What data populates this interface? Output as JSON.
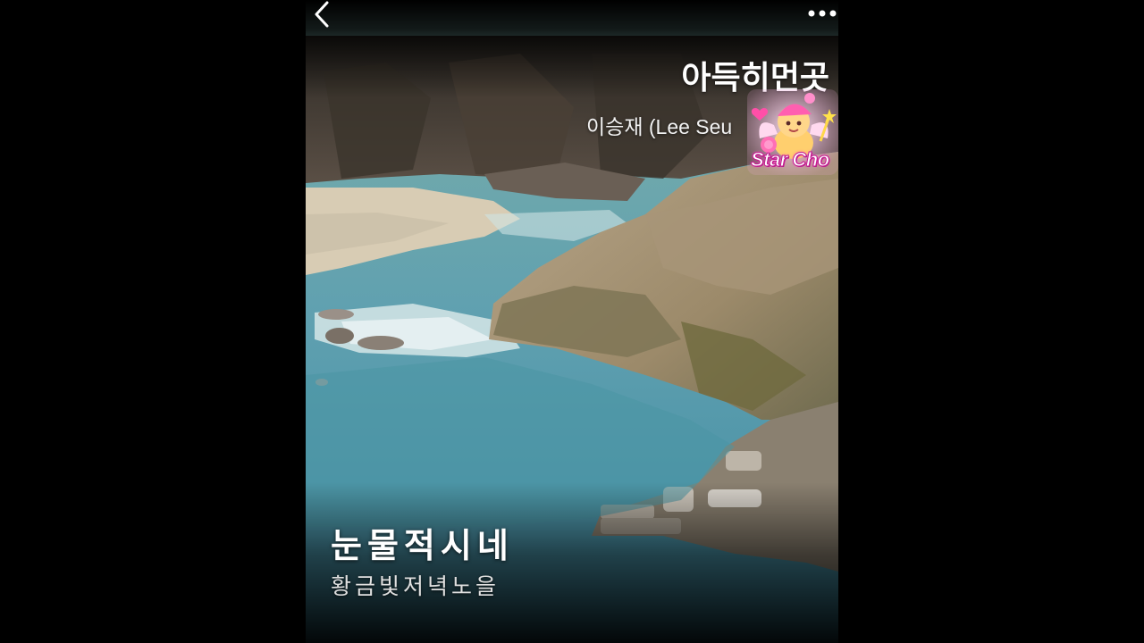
{
  "header": {
    "back_icon": "chevron-left-icon",
    "more_icon": "more-horizontal-icon"
  },
  "song": {
    "title": "아득히먼곳",
    "artist": "이승재 (Lee Seu"
  },
  "badge": {
    "label": "Star Cho"
  },
  "lyrics": {
    "current": "눈물적시네",
    "next": "황금빛저녁노을"
  },
  "colors": {
    "background": "#000000",
    "text": "#ffffff",
    "badge_accent": "#ff3fbf"
  }
}
